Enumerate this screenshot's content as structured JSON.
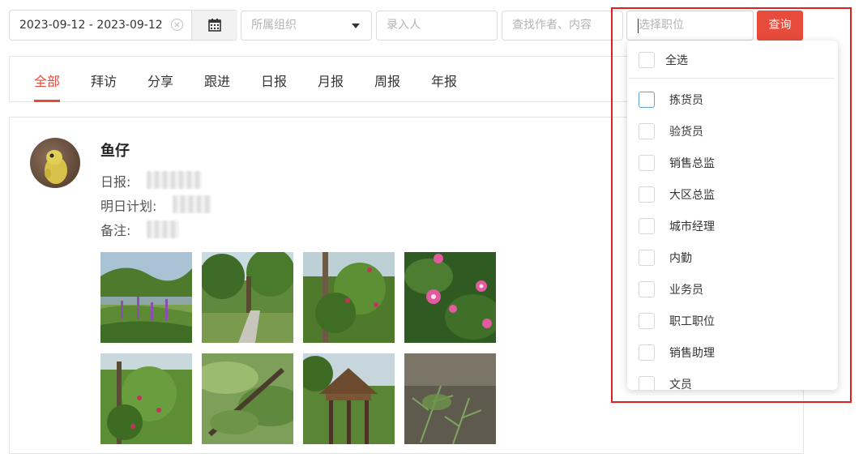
{
  "filters": {
    "date_range": "2023-09-12 - 2023-09-12",
    "org_placeholder": "所属组织",
    "author_placeholder": "录入人",
    "search_placeholder": "查找作者、内容",
    "position_placeholder": "选择职位",
    "query_label": "查询"
  },
  "tabs": [
    {
      "label": "全部",
      "active": true
    },
    {
      "label": "拜访"
    },
    {
      "label": "分享"
    },
    {
      "label": "跟进"
    },
    {
      "label": "日报"
    },
    {
      "label": "月报"
    },
    {
      "label": "周报"
    },
    {
      "label": "年报"
    }
  ],
  "post": {
    "author": "鱼仔",
    "daily_label": "日报:",
    "plan_label": "明日计划:",
    "note_label": "备注:"
  },
  "dropdown": {
    "select_all": "全选",
    "options": [
      "拣货员",
      "验货员",
      "销售总监",
      "大区总监",
      "城市经理",
      "内勤",
      "业务员",
      "职工职位",
      "销售助理",
      "文员"
    ]
  },
  "colors": {
    "accent": "#e64b3c",
    "highlight_border": "#e02020"
  }
}
